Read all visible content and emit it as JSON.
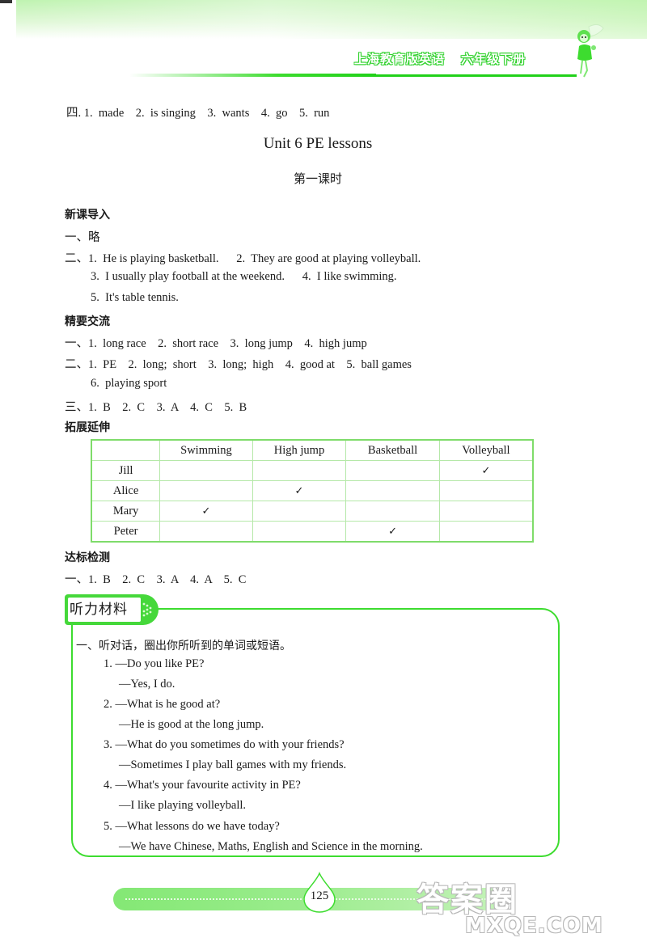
{
  "header": {
    "book_title": "上海教育版英语",
    "grade": "六年级下册"
  },
  "prev_answers": {
    "line": "四. 1.  made    2.  is singing    3.  wants    4.  go    5.  run"
  },
  "unit_title": "Unit 6  PE  lessons",
  "lesson_title": "第一课时",
  "sections": {
    "intro": {
      "heading": "新课导入",
      "lines": [
        "一、略",
        "二、1.  He is playing basketball.      2.  They are good at playing volleyball.",
        "3.  I usually play football at the weekend.      4.  I like swimming.",
        "5.  It's table tennis."
      ]
    },
    "exchange": {
      "heading": "精要交流",
      "lines": [
        "一、1.  long race    2.  short race    3.  long jump    4.  high jump",
        "二、1.  PE    2.  long;  short    3.  long;  high    4.  good at    5.  ball games",
        "6.  playing sport",
        "三、1.  B    2.  C    3.  A    4.  C    5.  B"
      ]
    },
    "extension": {
      "heading": "拓展延伸",
      "table": {
        "columns": [
          "",
          "Swimming",
          "High jump",
          "Basketball",
          "Volleyball"
        ],
        "rows": [
          {
            "name": "Jill",
            "cells": [
              "",
              "",
              "",
              "✓"
            ]
          },
          {
            "name": "Alice",
            "cells": [
              "",
              "✓",
              "",
              ""
            ]
          },
          {
            "name": "Mary",
            "cells": [
              "✓",
              "",
              "",
              ""
            ]
          },
          {
            "name": "Peter",
            "cells": [
              "",
              "",
              "✓",
              ""
            ]
          }
        ]
      }
    },
    "test": {
      "heading": "达标检测",
      "lines": [
        "一、1.  B    2.  C    3.  A    4.  A    5.  C"
      ]
    }
  },
  "listening": {
    "tab_label": "听力材料",
    "instruction": "一、听对话，圈出你所听到的单词或短语。",
    "dialogues": [
      {
        "q": "1. —Do you like PE?",
        "a": "—Yes, I do."
      },
      {
        "q": "2. —What is he good at?",
        "a": "—He is good at the long jump."
      },
      {
        "q": "3. —What do you sometimes do with your friends?",
        "a": "—Sometimes I play ball games with my friends."
      },
      {
        "q": "4. —What's your favourite activity in PE?",
        "a": "—I like playing volleyball."
      },
      {
        "q": "5. —What lessons do we have today?",
        "a": "—We have Chinese, Maths, English and Science in the morning."
      }
    ]
  },
  "footer": {
    "page_number": "125"
  },
  "watermark": {
    "cn": "答案圈",
    "url": "MXQE.COM"
  },
  "colors": {
    "accent_green": "#3ddc2f"
  }
}
